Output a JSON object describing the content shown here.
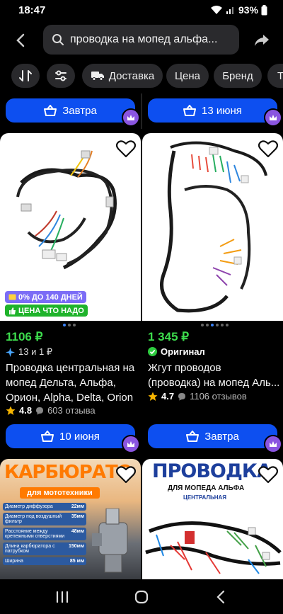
{
  "status": {
    "time": "18:47",
    "battery": "93%"
  },
  "search": {
    "query": "проводка на мопед альфа..."
  },
  "filters": {
    "delivery": "Доставка",
    "price": "Цена",
    "brand": "Бренд",
    "more": "Т"
  },
  "top_buttons": {
    "left": "Завтра",
    "right": "13 июня"
  },
  "products": [
    {
      "promo1": "0% ДО 140 ДНЕЙ",
      "promo2": "ЦЕНА ЧТО НАДО",
      "price": "1106 ₽",
      "sub": "13 и 1 ₽",
      "title_line1": "Проводка центральная на",
      "title_line2": "мопед Дельта, Альфа,",
      "title_line3": "Орион, Alpha, Delta, Orion",
      "rating": "4.8",
      "reviews": "603 отзыва",
      "delivery": "10 июня"
    },
    {
      "price": "1 345 ₽",
      "sub": "Оригинал",
      "title_line1": "Жгут проводов",
      "title_line2": "(проводка) на мопед Аль...",
      "rating": "4.7",
      "reviews": "1106 отзывов",
      "delivery": "Завтра"
    }
  ],
  "bottom_cards": {
    "left": {
      "banner_title": "КАРБЮРАТО",
      "banner_sub": "для мототехники",
      "specs": [
        {
          "label": "Диаметр диффузора",
          "value": "22мм"
        },
        {
          "label": "Диаметр под воздушный фильтр",
          "value": "35мм"
        },
        {
          "label": "Расстояние между крепежными отверстиями",
          "value": "48мм"
        },
        {
          "label": "Длина карбюратора с патрубком",
          "value": "150мм"
        },
        {
          "label": "Ширина",
          "value": "85 мм"
        }
      ]
    },
    "right": {
      "banner_title": "ПРОВОДКА",
      "banner_sub": "ДЛЯ МОПЕДА АЛЬФА",
      "banner_sub2": "ЦЕНТРАЛЬНАЯ"
    }
  }
}
